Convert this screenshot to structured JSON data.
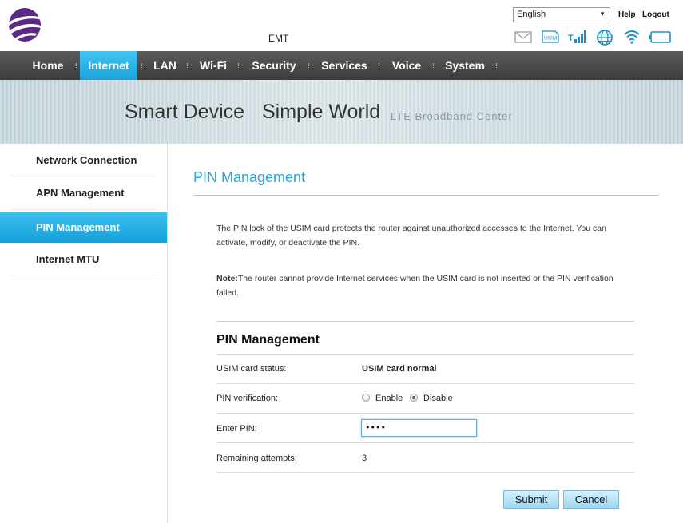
{
  "header": {
    "carrier": "EMT",
    "language": "English",
    "help": "Help",
    "logout": "Logout",
    "status_icons": [
      "message-icon",
      "usim-icon",
      "signal-icon",
      "globe-icon",
      "wifi-icon",
      "battery-icon"
    ],
    "usim_text": "USIM",
    "brand_color": "#5b2a86"
  },
  "nav": {
    "items": [
      "Home",
      "Internet",
      "LAN",
      "Wi-Fi",
      "Security",
      "Services",
      "Voice",
      "System"
    ],
    "active": "Internet",
    "active_color": "#1aa3dc"
  },
  "banner": {
    "part1": "Smart Device",
    "part2": "Simple World",
    "part3": "LTE Broadband Center"
  },
  "sidebar": {
    "items": [
      "Network Connection",
      "APN Management",
      "PIN Management",
      "Internet MTU"
    ],
    "active": "PIN Management"
  },
  "main": {
    "title": "PIN Management",
    "description": "The PIN lock of the USIM card protects the router against unauthorized accesses to the Internet. You can activate, modify, or deactivate the PIN.",
    "note_label": "Note:",
    "note_text": "The router cannot provide Internet services when the USIM card is not inserted or the PIN verification failed.",
    "section_title": "PIN Management",
    "rows": {
      "usim_status_label": "USIM card status:",
      "usim_status_value": "USIM card normal",
      "pin_verification_label": "PIN verification:",
      "enable_label": "Enable",
      "disable_label": "Disable",
      "pin_verification_selected": "Disable",
      "enter_pin_label": "Enter PIN:",
      "enter_pin_value": "••••",
      "remaining_label": "Remaining attempts:",
      "remaining_value": "3"
    },
    "submit": "Submit",
    "cancel": "Cancel"
  }
}
